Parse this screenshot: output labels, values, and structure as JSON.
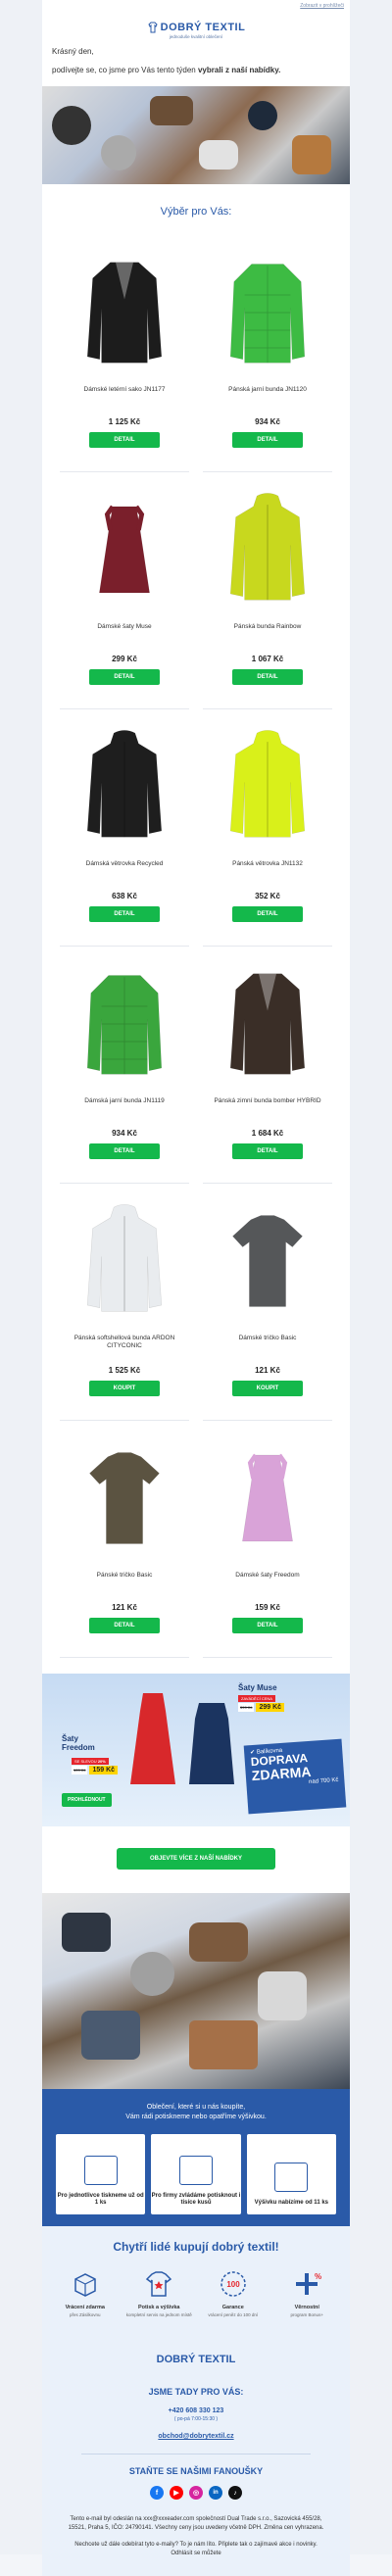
{
  "top_link": "Zobrazit v prohlížeči",
  "logo": {
    "name": "DOBRÝ TEXTIL",
    "tagline": "jednoduše kvalitní oblečení"
  },
  "greeting": {
    "line1": "Krásný den,",
    "line2_start": "podívejte se, co jsme pro Vás tento týden ",
    "line2_bold": "vybrali z naší nabídky."
  },
  "section_title": "Výběr pro Vás:",
  "products": [
    {
      "name": "Dámské letérní sako JN1177",
      "price": "1 125 Kč",
      "button": "DETAIL",
      "color": "#1c1c1c",
      "type": "jacket"
    },
    {
      "name": "Pánská jarní bunda JN1120",
      "price": "934 Kč",
      "button": "DETAIL",
      "color": "#3dbb43",
      "type": "puffer"
    },
    {
      "name": "Dámské šaty Muse",
      "price": "299 Kč",
      "button": "DETAIL",
      "color": "#7a1f2b",
      "type": "dress"
    },
    {
      "name": "Pánská bunda Rainbow",
      "price": "1 067 Kč",
      "button": "DETAIL",
      "color": "#c8d81e",
      "type": "hoodie"
    },
    {
      "name": "Dámská větrovka Recycled",
      "price": "638 Kč",
      "button": "DETAIL",
      "color": "#1e1e1e",
      "type": "hoodie"
    },
    {
      "name": "Pánská větrovka JN1132",
      "price": "352 Kč",
      "button": "DETAIL",
      "color": "#d9f01a",
      "type": "hoodie"
    },
    {
      "name": "Dámská jarní bunda JN1119",
      "price": "934 Kč",
      "button": "DETAIL",
      "color": "#3aa63d",
      "type": "puffer"
    },
    {
      "name": "Pánská zimní bunda bomber HYBRID",
      "price": "1 684 Kč",
      "button": "DETAIL",
      "color": "#3a2e27",
      "type": "jacket"
    },
    {
      "name": "Pánská softshellová bunda ARDON CITYCONIC",
      "price": "1 525 Kč",
      "button": "KOUPIT",
      "color": "#e9ecef",
      "type": "hoodie"
    },
    {
      "name": "Dámské tričko Basic",
      "price": "121 Kč",
      "button": "KOUPIT",
      "color": "#555759",
      "type": "tshirt"
    },
    {
      "name": "Pánské tričko Basic",
      "price": "121 Kč",
      "button": "DETAIL",
      "color": "#5b5341",
      "type": "tshirt"
    },
    {
      "name": "Dámské šaty Freedom",
      "price": "159 Kč",
      "button": "DETAIL",
      "color": "#d9a3d8",
      "type": "dress"
    }
  ],
  "banner": {
    "left_title": "Šaty Freedom",
    "left_badge": "SE SLEVOU",
    "left_pct": "20%",
    "left_old": "199 Kč",
    "left_new": "159 Kč",
    "right_title": "Šaty Muse",
    "right_badge": "ZAVÁDĚCÍ CENA",
    "right_old": "399 Kč",
    "right_new": "299 Kč",
    "cta": "PROHLÉDNOUT",
    "delivery_brand": "Balíkovna",
    "delivery_text1": "DOPRAVA",
    "delivery_text2": "ZDARMA",
    "delivery_text3": "nad 700 Kč"
  },
  "cta_more": "OBJEVTE VÍCE Z NAŠÍ NABÍDKY",
  "print": {
    "text1": "Oblečení, které si u nás koupíte,",
    "text2": "Vám rádi potiskneme nebo opatříme výšivkou.",
    "steps": [
      "Pro jednotlivce tiskneme už od 1 ks",
      "Pro firmy zvládáme potisknout i tisíce kusů",
      "Výšivku nabízíme od 11 ks"
    ]
  },
  "why": {
    "title": "Chytří lidé kupují dobrý textil!",
    "features": [
      {
        "label": "Vrácení zdarma",
        "sub": "přes Zásilkovnu"
      },
      {
        "label": "Potisk a výšivka",
        "sub": "kompletní servis na jednom místě"
      },
      {
        "label": "Garance",
        "sub": "vrácení peněz do 100 dní"
      },
      {
        "label": "Věrnostní",
        "sub": "program Bonus+"
      }
    ]
  },
  "footer": {
    "logo": "DOBRÝ TEXTIL",
    "contact_title": "JSME TADY PRO VÁS:",
    "phone": "+420 608 330 123",
    "hours": "( po-pá 7:00-15:30 )",
    "email": "obchod@dobrytextil.cz",
    "fans_title": "STAŇTE SE NAŠIMI FANOUŠKY",
    "legal1": "Tento e-mail byl odeslán na xxx@xxxeader.com společností Dual Trade s.r.o., Sazovická 455/28, 15521, Praha 5, IČO: 24790141. Všechny ceny jsou uvedeny včetně DPH. Změna cen vyhrazena.",
    "legal2": "Nechcete už dále odebírat tyto e-maily? To je nám líto. Připlete tak o zajímavé akce i novinky. Odhlásit se můžete"
  },
  "colors": {
    "brand": "#2a5aa8",
    "green": "#14b84b"
  }
}
